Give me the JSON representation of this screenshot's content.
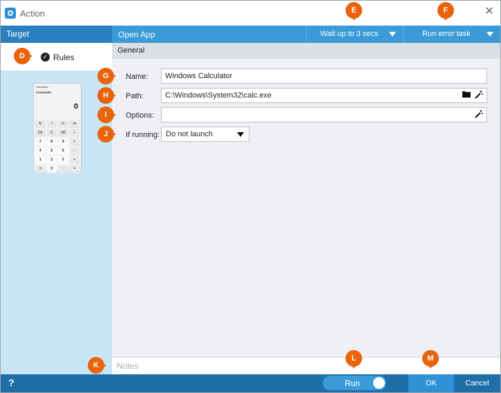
{
  "window": {
    "title": "Action",
    "close_glyph": "✕"
  },
  "header": {
    "target_label": "Target",
    "action_title": "Open App",
    "wait_dropdown": "Wait up to 3 secs",
    "error_dropdown": "Run error task"
  },
  "left_panel": {
    "rules_label": "Rules",
    "calculator": {
      "title": "Calculator",
      "mode": "STANDARD",
      "display": "0",
      "keys": [
        "%",
        "√",
        "x²",
        "⅟x",
        "CE",
        "C",
        "⌫",
        "÷",
        "7",
        "8",
        "9",
        "×",
        "4",
        "5",
        "6",
        "−",
        "1",
        "2",
        "3",
        "+",
        "±",
        "0",
        ".",
        "="
      ]
    }
  },
  "main": {
    "section_tab": "General",
    "form": {
      "name_label": "Name:",
      "name_value": "Windows Calculator",
      "path_label": "Path:",
      "path_value": "C:\\Windows\\System32\\calc.exe",
      "options_label": "Options:",
      "options_value": "",
      "if_running_label": "If running:",
      "if_running_value": "Do not launch"
    }
  },
  "notes_placeholder": "Notes",
  "bottom": {
    "help": "?",
    "run_label": "Run",
    "ok_label": "OK",
    "cancel_label": "Cancel"
  },
  "callouts": [
    "D",
    "E",
    "F",
    "G",
    "H",
    "I",
    "J",
    "K",
    "L",
    "M"
  ],
  "colors": {
    "accent": "#3a9bd8",
    "bottom_bar": "#1f6ea8",
    "target_panel": "#c8e6f8",
    "callout": "#e8630a"
  },
  "icons": {
    "folder": "folder-icon",
    "wand": "magic-wand-icon",
    "check": "checkmark-icon"
  }
}
